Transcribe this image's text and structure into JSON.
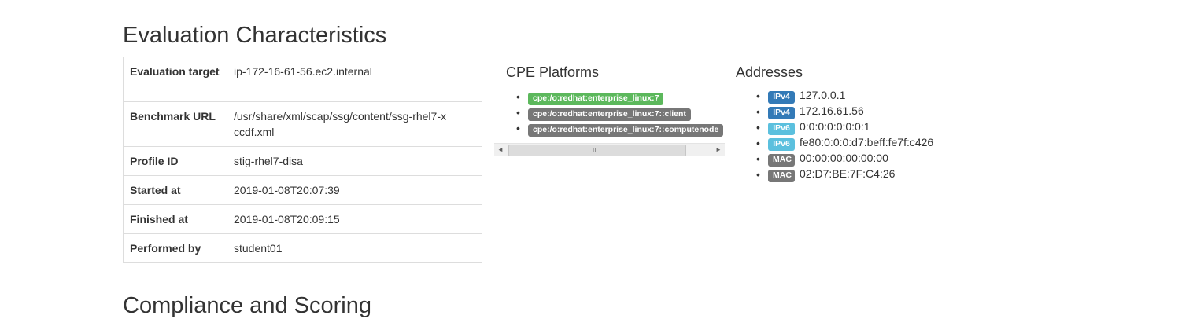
{
  "sections": {
    "evaluation_title": "Evaluation Characteristics",
    "compliance_title": "Compliance and Scoring"
  },
  "eval_table": [
    {
      "key": "Evaluation target",
      "value": "ip-172-16-61-56.ec2.internal"
    },
    {
      "key": "Benchmark URL",
      "value": "/usr/share/xml/scap/ssg/content/ssg-rhel7-xccdf.xml"
    },
    {
      "key": "Profile ID",
      "value": "stig-rhel7-disa"
    },
    {
      "key": "Started at",
      "value": "2019-01-08T20:07:39"
    },
    {
      "key": "Finished at",
      "value": "2019-01-08T20:09:15"
    },
    {
      "key": "Performed by",
      "value": "student01"
    }
  ],
  "cpe": {
    "title": "CPE Platforms",
    "items": [
      {
        "label": "cpe:/o:redhat:enterprise_linux:7",
        "color": "#5cb85c"
      },
      {
        "label": "cpe:/o:redhat:enterprise_linux:7::client",
        "color": "#777777"
      },
      {
        "label": "cpe:/o:redhat:enterprise_linux:7::computenode",
        "color": "#777777"
      }
    ],
    "scrollbar_grip": "III"
  },
  "addresses": {
    "title": "Addresses",
    "items": [
      {
        "type": "IPv4",
        "value": "127.0.0.1",
        "color": "#337ab7"
      },
      {
        "type": "IPv4",
        "value": "172.16.61.56",
        "color": "#337ab7"
      },
      {
        "type": "IPv6",
        "value": "0:0:0:0:0:0:0:1",
        "color": "#5bc0de"
      },
      {
        "type": "IPv6",
        "value": "fe80:0:0:0:d7:beff:fe7f:c426",
        "color": "#5bc0de"
      },
      {
        "type": "MAC",
        "value": "00:00:00:00:00:00",
        "color": "#777777"
      },
      {
        "type": "MAC",
        "value": "02:D7:BE:7F:C4:26",
        "color": "#777777"
      }
    ]
  }
}
